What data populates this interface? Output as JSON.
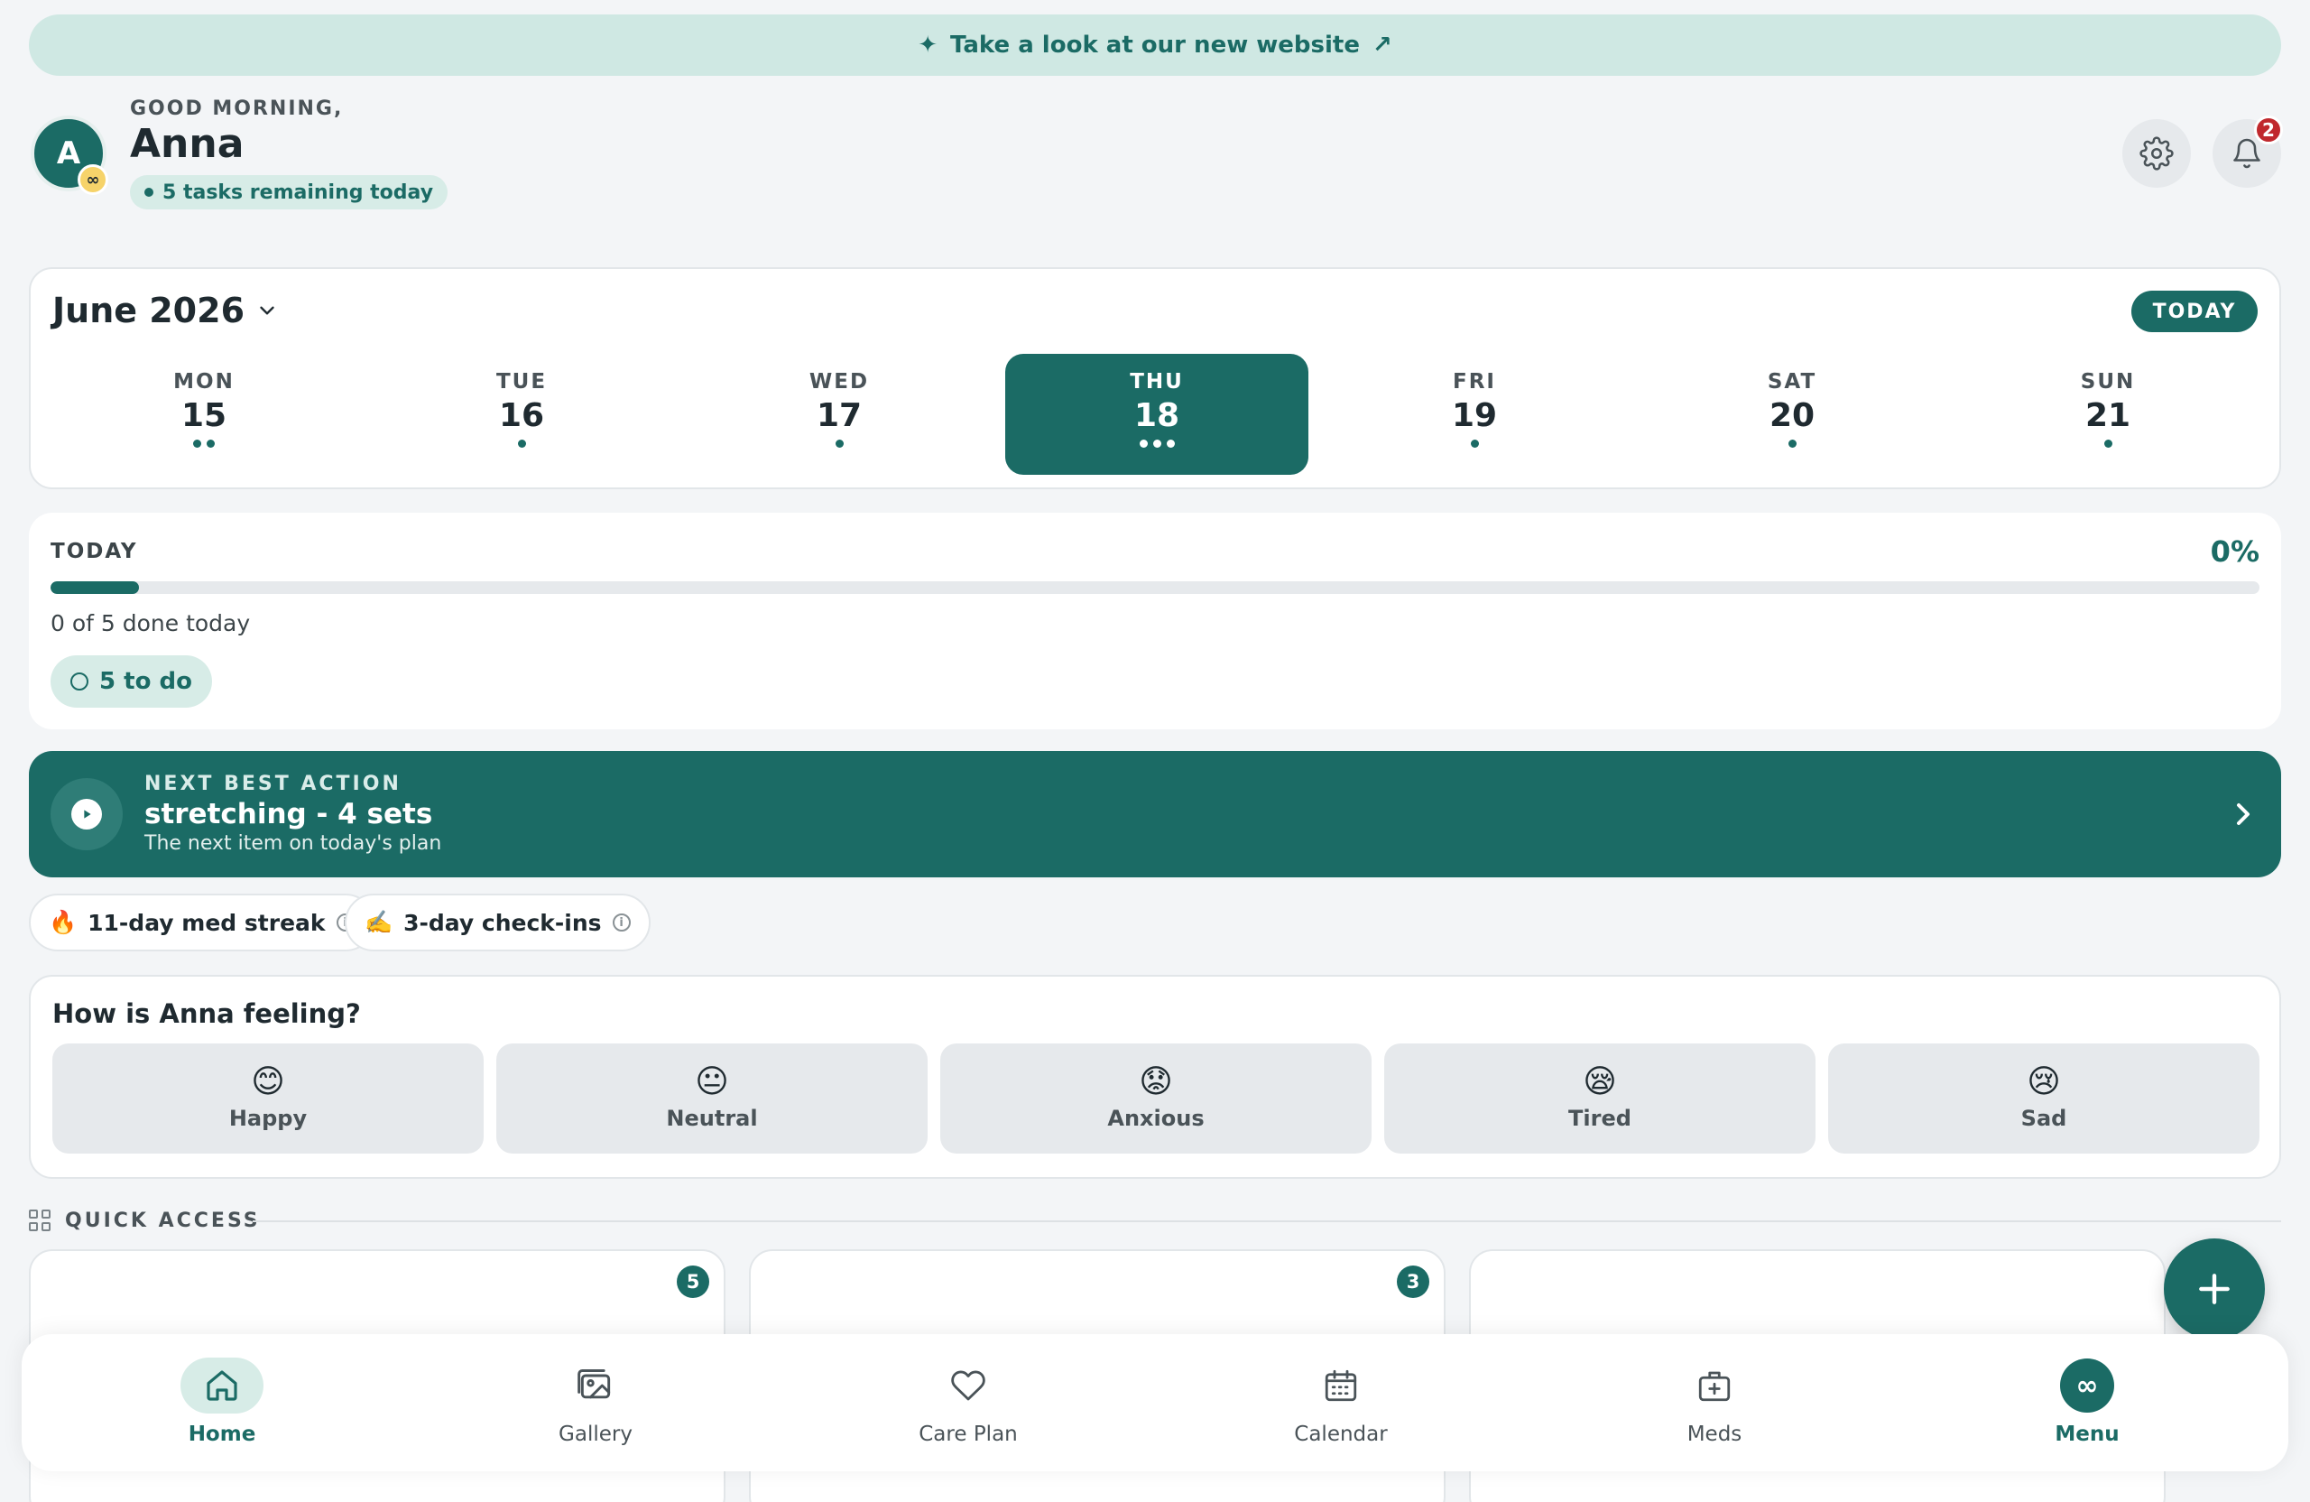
{
  "banner": {
    "text": "Take a look at our new website"
  },
  "header": {
    "avatar_initial": "A",
    "avatar_badge": "∞",
    "greeting": "GOOD MORNING,",
    "name": "Anna",
    "tasks_remaining": "5 tasks remaining today",
    "notification_count": "2"
  },
  "calendar": {
    "month": "June 2026",
    "today_button": "TODAY",
    "days": [
      {
        "name": "MON",
        "num": "15",
        "dots": 2
      },
      {
        "name": "TUE",
        "num": "16",
        "dots": 1
      },
      {
        "name": "WED",
        "num": "17",
        "dots": 1
      },
      {
        "name": "THU",
        "num": "18",
        "dots": 3,
        "active": true
      },
      {
        "name": "FRI",
        "num": "19",
        "dots": 1
      },
      {
        "name": "SAT",
        "num": "20",
        "dots": 1
      },
      {
        "name": "SUN",
        "num": "21",
        "dots": 1
      }
    ]
  },
  "today": {
    "label": "TODAY",
    "percent_text": "0%",
    "bar_fill_fraction": 0.04,
    "summary": "0 of 5 done today",
    "todo": "5 to do"
  },
  "next_best_action": {
    "kicker": "NEXT BEST ACTION",
    "title": "stretching - 4 sets",
    "subtitle": "The next item on today's plan"
  },
  "streaks": [
    {
      "emoji": "🔥",
      "label": "11-day med streak"
    },
    {
      "emoji": "✍️",
      "label": "3-day check-ins"
    }
  ],
  "feeling": {
    "title": "How is Anna feeling?",
    "moods": [
      {
        "emoji": "😊",
        "label": "Happy"
      },
      {
        "emoji": "😐",
        "label": "Neutral"
      },
      {
        "emoji": "😟",
        "label": "Anxious"
      },
      {
        "emoji": "😪",
        "label": "Tired"
      },
      {
        "emoji": "😢",
        "label": "Sad"
      }
    ]
  },
  "quick_access": {
    "label": "QUICK ACCESS",
    "cards": [
      {
        "badge": "5"
      },
      {
        "badge": "3"
      },
      {
        "badge": ""
      }
    ]
  },
  "nav": {
    "items": [
      {
        "label": "Home",
        "icon": "home-icon"
      },
      {
        "label": "Gallery",
        "icon": "gallery-icon"
      },
      {
        "label": "Care Plan",
        "icon": "heart-icon"
      },
      {
        "label": "Calendar",
        "icon": "calendar-icon"
      },
      {
        "label": "Meds",
        "icon": "medkit-icon"
      },
      {
        "label": "Menu",
        "icon": "infinity-icon"
      }
    ],
    "menu_symbol": "∞"
  },
  "colors": {
    "accent": "#1b6b65",
    "accent_light": "#d7ece7",
    "badge_red": "#c0282d"
  }
}
